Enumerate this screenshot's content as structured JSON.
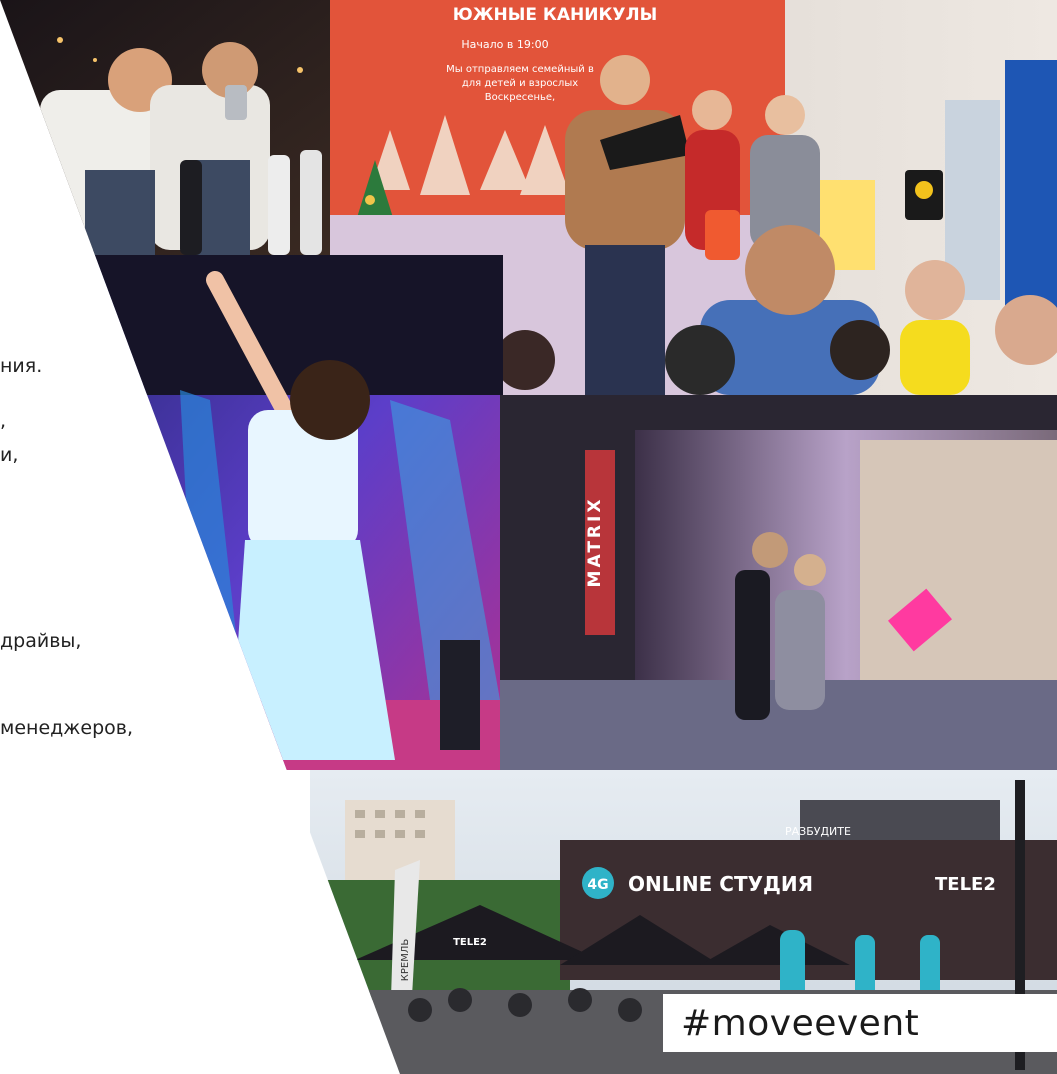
{
  "side_text": {
    "line1": "ния.",
    "line2": ",",
    "line3": "и,",
    "line4": "драйвы,",
    "line5": "менеджеров,"
  },
  "banner": {
    "title": "ЮЖНЫЕ  КАНИКУЛЫ",
    "time": "Начало в 19:00",
    "desc1": "Мы отправляем семейный в",
    "desc2": "для детей и взрослых",
    "desc3": "Воскресенье,"
  },
  "stage": {
    "brand_vertical": "MATRIX"
  },
  "studio": {
    "badge": "4G",
    "title": "ONLINE СТУДИЯ",
    "brand": "TELE2",
    "umbrella_brand": "TELE2",
    "banner_text": "РАЗБУДИТЕ",
    "flag_text": "КРЕМЛЬ"
  },
  "hashtag": "#moveevent",
  "colors": {
    "banner_red": "#e2543a",
    "stage_purple": "#7b4fd6",
    "studio_dark": "#3b2d30",
    "badge_teal": "#2fb3c8"
  }
}
